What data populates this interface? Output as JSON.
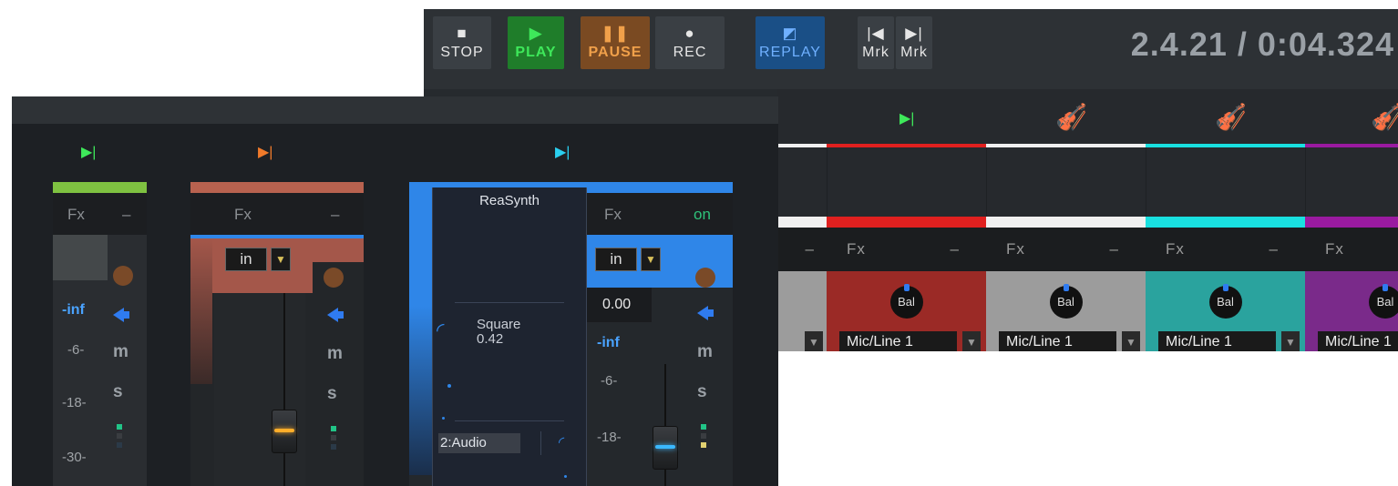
{
  "transport": {
    "stop_label": "STOP",
    "play_label": "PLAY",
    "pause_label": "PAUSE",
    "rec_label": "REC",
    "replay_label": "REPLAY",
    "prev_marker_label": "Mrk",
    "next_marker_label": "Mrk",
    "clock": "2.4.21 / 0:04.324"
  },
  "back_tracks": [
    {
      "color": "#e0201f",
      "fx_label": "Fx",
      "fx_dash": "–",
      "pan_label": "Bal",
      "input": "Mic/Line 1",
      "panel_color": "#9b2a26",
      "header_icon": "play-marker-icon"
    },
    {
      "color": "#f0f0f0",
      "fx_label": "Fx",
      "fx_dash": "–",
      "pan_label": "Bal",
      "input": "Mic/Line 1",
      "panel_color": "#9c9c9c",
      "header_icon": "violin-icon"
    },
    {
      "color": "#19e0e0",
      "fx_label": "Fx",
      "fx_dash": "–",
      "pan_label": "Bal",
      "input": "Mic/Line 1",
      "panel_color": "#2aa39e",
      "header_icon": "violin-icon"
    },
    {
      "color": "#9a1aa0",
      "fx_label": "Fx",
      "fx_dash": "",
      "pan_label": "Bal",
      "input": "Mic/Line 1",
      "panel_color": "#7a2a8a",
      "header_icon": "violin-icon"
    }
  ],
  "back_partial_dash": "–",
  "mixer": {
    "strip1": {
      "color": "#7fc241",
      "fx_label": "Fx",
      "fx_dash": "–",
      "vol": "-inf",
      "m": "m",
      "s": "s",
      "scale": [
        "-6-",
        "-18-",
        "-30-"
      ]
    },
    "strip2": {
      "color": "#b8624f",
      "fx_label": "Fx",
      "fx_dash": "–",
      "input_label": "in",
      "m": "m",
      "s": "s"
    },
    "strip3": {
      "color": "#2f86e8",
      "fx_label": "Fx",
      "fx_on": "on",
      "input_label": "in",
      "vol_db": "0.00",
      "vol": "-inf",
      "m": "m",
      "s": "s",
      "scale": [
        "-6-",
        "-18-"
      ]
    }
  },
  "reasynth": {
    "title": "ReaSynth",
    "param_name": "Square",
    "param_value": "0.42",
    "channel": "2:Audio"
  }
}
